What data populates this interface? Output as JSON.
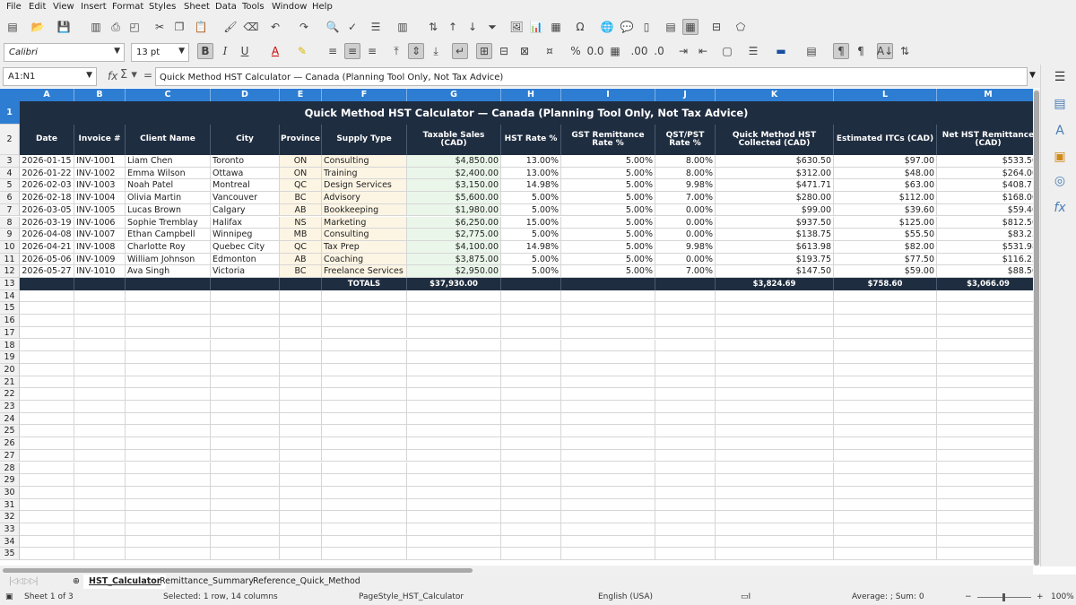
{
  "menu": [
    "File",
    "Edit",
    "View",
    "Insert",
    "Format",
    "Styles",
    "Sheet",
    "Data",
    "Tools",
    "Window",
    "Help"
  ],
  "font_name": "Calibri",
  "font_size": "13 pt",
  "toolbar": {
    "bold": "B",
    "italic": "I",
    "underline": "U"
  },
  "name_box": "A1:N1",
  "formula": "Quick Method HST Calculator — Canada (Planning Tool Only, Not Tax Advice)",
  "columns": [
    "A",
    "B",
    "C",
    "D",
    "E",
    "F",
    "G",
    "H",
    "I",
    "J",
    "K",
    "L",
    "M"
  ],
  "title": "Quick Method HST Calculator — Canada (Planning Tool Only, Not Tax Advice)",
  "headers": [
    "Date",
    "Invoice #",
    "Client Name",
    "City",
    "Province",
    "Supply Type",
    "Taxable Sales (CAD)",
    "HST Rate %",
    "GST Remittance Rate %",
    "QST/PST Rate %",
    "Quick Method HST Collected (CAD)",
    "Estimated ITCs (CAD)",
    "Net HST Remittance (CAD)"
  ],
  "rows": [
    [
      "2026-01-15",
      "INV-1001",
      "Liam Chen",
      "Toronto",
      "ON",
      "Consulting",
      "$4,850.00",
      "13.00%",
      "5.00%",
      "8.00%",
      "$630.50",
      "$97.00",
      "$533.50"
    ],
    [
      "2026-01-22",
      "INV-1002",
      "Emma Wilson",
      "Ottawa",
      "ON",
      "Training",
      "$2,400.00",
      "13.00%",
      "5.00%",
      "8.00%",
      "$312.00",
      "$48.00",
      "$264.00"
    ],
    [
      "2026-02-03",
      "INV-1003",
      "Noah Patel",
      "Montreal",
      "QC",
      "Design Services",
      "$3,150.00",
      "14.98%",
      "5.00%",
      "9.98%",
      "$471.71",
      "$63.00",
      "$408.71"
    ],
    [
      "2026-02-18",
      "INV-1004",
      "Olivia Martin",
      "Vancouver",
      "BC",
      "Advisory",
      "$5,600.00",
      "5.00%",
      "5.00%",
      "7.00%",
      "$280.00",
      "$112.00",
      "$168.00"
    ],
    [
      "2026-03-05",
      "INV-1005",
      "Lucas Brown",
      "Calgary",
      "AB",
      "Bookkeeping",
      "$1,980.00",
      "5.00%",
      "5.00%",
      "0.00%",
      "$99.00",
      "$39.60",
      "$59.40"
    ],
    [
      "2026-03-19",
      "INV-1006",
      "Sophie Tremblay",
      "Halifax",
      "NS",
      "Marketing",
      "$6,250.00",
      "15.00%",
      "5.00%",
      "0.00%",
      "$937.50",
      "$125.00",
      "$812.50"
    ],
    [
      "2026-04-08",
      "INV-1007",
      "Ethan Campbell",
      "Winnipeg",
      "MB",
      "Consulting",
      "$2,775.00",
      "5.00%",
      "5.00%",
      "0.00%",
      "$138.75",
      "$55.50",
      "$83.25"
    ],
    [
      "2026-04-21",
      "INV-1008",
      "Charlotte Roy",
      "Quebec City",
      "QC",
      "Tax Prep",
      "$4,100.00",
      "14.98%",
      "5.00%",
      "9.98%",
      "$613.98",
      "$82.00",
      "$531.98"
    ],
    [
      "2026-05-06",
      "INV-1009",
      "William Johnson",
      "Edmonton",
      "AB",
      "Coaching",
      "$3,875.00",
      "5.00%",
      "5.00%",
      "0.00%",
      "$193.75",
      "$77.50",
      "$116.25"
    ],
    [
      "2026-05-27",
      "INV-1010",
      "Ava Singh",
      "Victoria",
      "BC",
      "Freelance Services",
      "$2,950.00",
      "5.00%",
      "5.00%",
      "7.00%",
      "$147.50",
      "$59.00",
      "$88.50"
    ]
  ],
  "totals": {
    "label": "TOTALS",
    "taxable": "$37,930.00",
    "hst": "$3,824.69",
    "itcs": "$758.60",
    "net": "$3,066.09"
  },
  "sheet_tabs": [
    "HST_Calculator",
    "Remittance_Summary",
    "Reference_Quick_Method"
  ],
  "status": {
    "sheet": "Sheet 1 of 3",
    "selection": "Selected: 1 row, 14 columns",
    "page_style": "PageStyle_HST_Calculator",
    "language": "English (USA)",
    "summary": "Average: ; Sum: 0",
    "zoom": "100%"
  }
}
